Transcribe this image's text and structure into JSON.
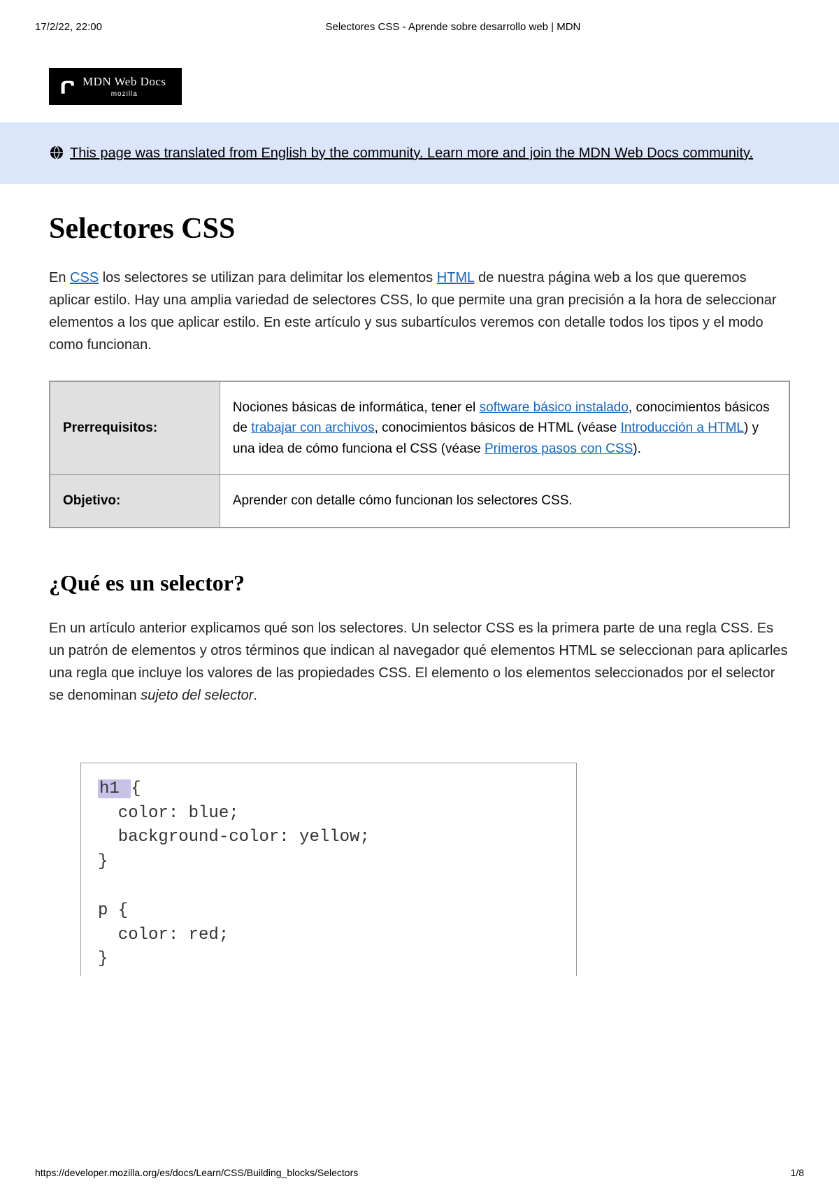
{
  "print": {
    "timestamp": "17/2/22, 22:00",
    "doc_title": "Selectores CSS - Aprende sobre desarrollo web | MDN",
    "url": "https://developer.mozilla.org/es/docs/Learn/CSS/Building_blocks/Selectors",
    "page_indicator": "1/8"
  },
  "logo": {
    "main": "MDN Web Docs",
    "sub": "mozilla"
  },
  "banner": {
    "link_text": "This page was translated from English by the community. Learn more and join the MDN Web Docs community."
  },
  "title": "Selectores CSS",
  "intro": {
    "pre_css": "En ",
    "css": "CSS",
    "mid": " los selectores se utilizan para delimitar los elementos ",
    "html": "HTML",
    "post": " de nuestra página web a los que queremos aplicar estilo. Hay una amplia variedad de selectores CSS, lo que permite una gran precisión a la hora de seleccionar elementos a los que aplicar estilo. En este artículo y sus subartículos veremos con detalle todos los tipos y el modo como funcionan."
  },
  "table": {
    "row1": {
      "label": "Prerrequisitos:",
      "t1": "Nociones básicas de informática, tener el ",
      "l1": "software básico instalado",
      "t2": ", conocimientos básicos de ",
      "l2": "trabajar con archivos",
      "t3": ", conocimientos básicos de HTML (véase ",
      "l3": "Introducción a HTML",
      "t4": ") y una idea de cómo funciona el CSS (véase ",
      "l4": "Primeros pasos con CSS",
      "t5": ")."
    },
    "row2": {
      "label": "Objetivo:",
      "value": "Aprender con detalle cómo funcionan los selectores CSS."
    }
  },
  "section": {
    "heading": "¿Qué es un selector?",
    "para_main": "En un artículo anterior explicamos qué son los selectores. Un selector CSS es la primera parte de una regla CSS. Es un patrón de elementos y otros términos que indican al navegador qué elementos HTML se seleccionan para aplicarles una regla que incluye los valores de las propiedades CSS. El elemento o los elementos seleccionados por el selector se denominan ",
    "para_italic": "sujeto del selector",
    "para_end": "."
  },
  "code": {
    "l1_hl": "h1 ",
    "l1_rest": "{",
    "l2": "  color: blue;",
    "l3": "  background-color: yellow;",
    "l4": "}",
    "l5": "",
    "l6": "p {",
    "l7": "  color: red;",
    "l8": "}"
  }
}
